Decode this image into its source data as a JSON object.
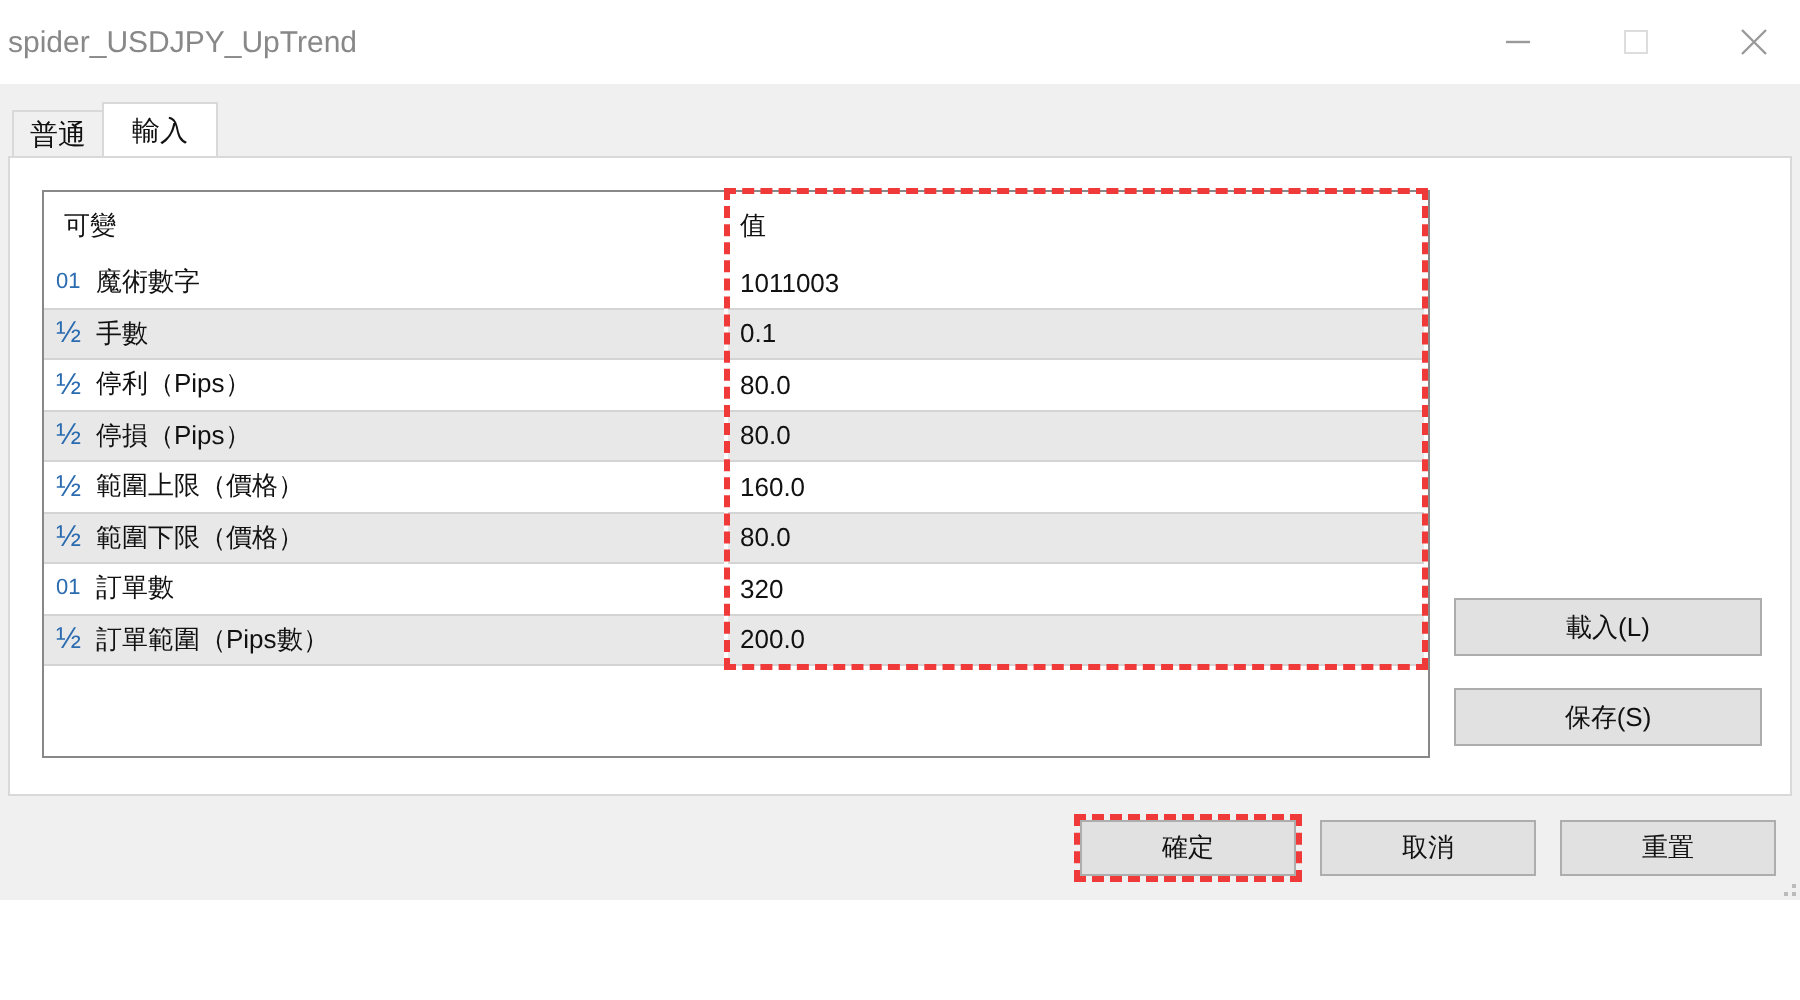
{
  "window": {
    "title": "spider_USDJPY_UpTrend"
  },
  "tabs": [
    {
      "label": "普通",
      "selected": false
    },
    {
      "label": "輸入",
      "selected": true
    }
  ],
  "table": {
    "columns": [
      {
        "label": "可變",
        "highlighted": false
      },
      {
        "label": "值",
        "highlighted": true
      }
    ],
    "rows": [
      {
        "kind": "int",
        "icon": "01",
        "name": "魔術數字",
        "value": "1011003"
      },
      {
        "kind": "double",
        "icon": "½",
        "name": "手數",
        "value": "0.1"
      },
      {
        "kind": "double",
        "icon": "½",
        "name": "停利（Pips）",
        "value": "80.0"
      },
      {
        "kind": "double",
        "icon": "½",
        "name": "停損（Pips）",
        "value": "80.0"
      },
      {
        "kind": "double",
        "icon": "½",
        "name": "範圍上限（價格）",
        "value": "160.0"
      },
      {
        "kind": "double",
        "icon": "½",
        "name": "範圍下限（價格）",
        "value": "80.0"
      },
      {
        "kind": "int",
        "icon": "01",
        "name": "訂單數",
        "value": "320"
      },
      {
        "kind": "double",
        "icon": "½",
        "name": "訂單範圍（Pips數）",
        "value": "200.0"
      }
    ]
  },
  "side_buttons": [
    {
      "label": "載入(L)"
    },
    {
      "label": "保存(S)"
    }
  ],
  "bottom_buttons": [
    {
      "label": "確定",
      "highlighted": true
    },
    {
      "label": "取消",
      "highlighted": false
    },
    {
      "label": "重置",
      "highlighted": false
    }
  ]
}
